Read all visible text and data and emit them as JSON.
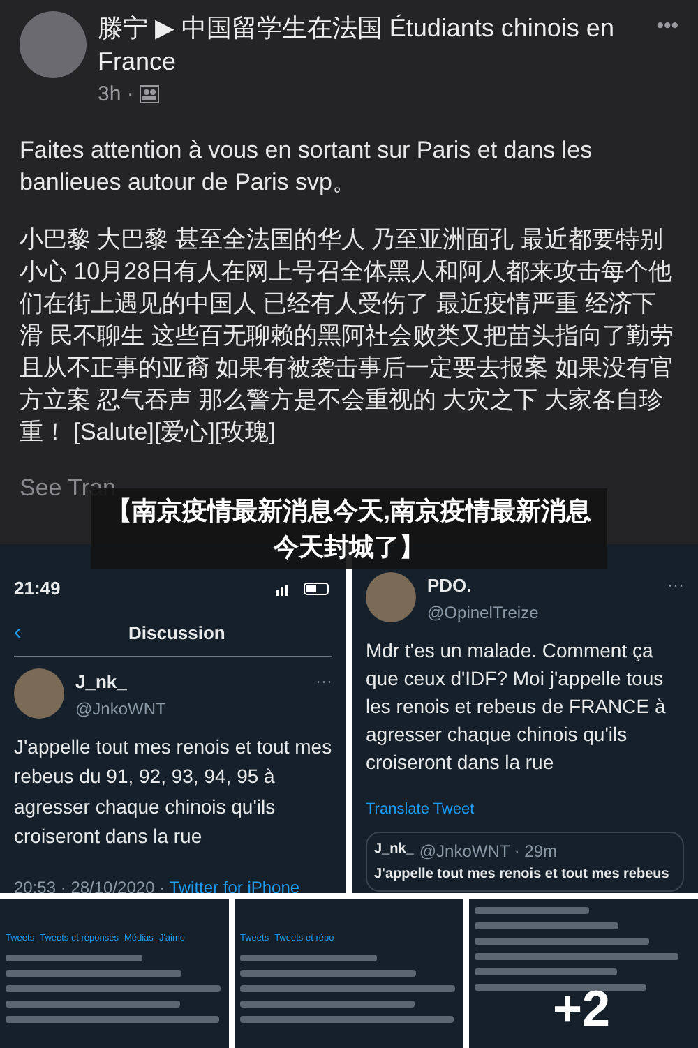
{
  "post": {
    "author": "滕宁",
    "arrow": "▶",
    "group": "中国留学生在法国 Étudiants chinois en France",
    "more": "•••",
    "time": "3h ·",
    "paragraphs": [
      "Faites attention à vous en sortant sur Paris et dans les banlieues autour de Paris svp。",
      "小巴黎 大巴黎 甚至全法国的华人 乃至亚洲面孔 最近都要特别小心 10月28日有人在网上号召全体黑人和阿人都来攻击每个他们在街上遇见的中国人 已经有人受伤了 最近疫情严重 经济下滑 民不聊生 这些百无聊赖的黑阿社会败类又把苗头指向了勤劳且从不正事的亚裔 如果有被袭击事后一定要去报案 如果没有官方立案 忍气吞声 那么警方是不会重视的 大灾之下 大家各自珍重！ [Salute][爱心][玫瑰]"
    ],
    "see_translation": "See Tran"
  },
  "caption": "【南京疫情最新消息今天,南京疫情最新消息今天封城了】",
  "tweets": [
    {
      "kind": "thread",
      "status_time": "21:49",
      "back": "‹",
      "title": "Discussion",
      "name": "J_nk_",
      "handle": "@JnkoWNT",
      "more": "···",
      "text": "J'appelle tout mes renois et tout mes rebeus du 91, 92, 93, 94, 95 à agresser chaque chinois qu'ils croiseront dans la rue",
      "meta": "20:53 · 28/10/2020 ·",
      "source": "Twitter for iPhone"
    },
    {
      "kind": "reply",
      "name": "PDO.",
      "handle": "@OpinelTreize",
      "more": "···",
      "text": "Mdr t'es un malade. Comment ça que ceux d'IDF? Moi j'appelle tous les renois et rebeus de FRANCE à agresser chaque chinois qu'ils croiseront dans la rue",
      "translate": "Translate Tweet",
      "quote": {
        "name": "J_nk_",
        "handle": "@JnkoWNT · 29m",
        "text": "J'appelle tout mes renois et tout mes rebeus"
      }
    }
  ],
  "thumbnails": [
    {
      "tabs": [
        "Tweets",
        "Tweets et réponses",
        "Médias",
        "J'aime"
      ]
    },
    {
      "tabs": [
        "Tweets",
        "Tweets et répo"
      ]
    },
    {
      "overlay": "+2"
    }
  ]
}
